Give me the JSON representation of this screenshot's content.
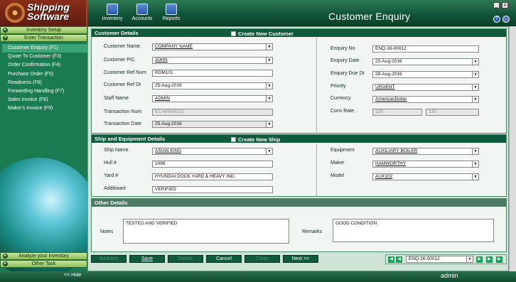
{
  "app": {
    "logo_line1": "Shipping",
    "logo_line2": "Software",
    "title": "Customer Enquiry",
    "user": "admin",
    "hide_label": "<< Hide"
  },
  "toolbar": [
    {
      "label": "Inventory",
      "icon": "inventory-icon"
    },
    {
      "label": "Accounts",
      "icon": "accounts-icon"
    },
    {
      "label": "Reports",
      "icon": "reports-icon"
    }
  ],
  "window_controls": {
    "minimize": "_",
    "close": "x",
    "help": "?"
  },
  "sidebar": {
    "inventory_setup": "Inventory Setup",
    "enter_transaction": "Enter Transaction",
    "items": [
      "Customer Enquiry (F1)",
      "Quote To Customer (F3)",
      "Order Confirmation (F4)",
      "Purchase Order (F5)",
      "Readiness (F6)",
      "Forwarding Handling (F7)",
      "Sales Invoice (F8)",
      "Maker's Invoice (F9)"
    ],
    "analyze": "Analyze your inventory",
    "other": "Other Task"
  },
  "customer": {
    "header": "Customer Details",
    "create_label": "Create New Customer",
    "name_label": "Customer Name",
    "name": "COMPANY NAME",
    "pic_label": "Customer PIC",
    "pic": "JOHN",
    "ref_label": "Customer Ref Num",
    "ref": "RDM101",
    "refdt_label": "Customer Ref Dt",
    "refdt": "25-Aug-2016",
    "staff_label": "Staff  Name",
    "staff": "ADMIN",
    "txnum_label": "Transaction Num",
    "txnum": "EC-60800013",
    "txdate_label": "Transaction Date",
    "txdate": "25-Aug-2016",
    "enq_label": "Enquiry No",
    "enq": "ENQ-16-00012",
    "enqdate_label": "Enquiry Date",
    "enqdate": "25-Aug-2016",
    "due_label": "Enquiry Due Dt",
    "due": "28-Aug-2016",
    "priority_label": "Priority",
    "priority": "URGENT",
    "currency_label": "Currency",
    "currency": "AmericanDollar",
    "conv_label": "Conv Rate",
    "conv1": "120",
    "conv2": "120"
  },
  "ship": {
    "header": "Ship and Equipment Details",
    "create_label": "Create New Ship",
    "name_label": "Ship Name",
    "name": "ASIAN KING",
    "hull_label": "Hull #",
    "hull": "1098",
    "yard_label": "Yard #",
    "yard": "HYUNDAI DOCK YARD & HEAVY IND.",
    "add_label": "Additioanl",
    "add": "VERIFIED",
    "equip_label": "Equipment",
    "equip": "AUXILIARY BOILER",
    "maker_label": "Maker",
    "maker": "HAMWORTHY",
    "model_label": "Model",
    "model": "AUX102"
  },
  "other": {
    "header": "Other Details",
    "notes_label": "Notes",
    "notes": "TESTED AND VERIFIED",
    "remarks_label": "Remarks",
    "remarks": "GOOD CONDITION"
  },
  "buttons": {
    "addnew": "AddNew",
    "save": "Save",
    "delete": "Delete",
    "cancel": "Cancel",
    "close": "Close",
    "next": "Next >>"
  },
  "navigator": {
    "current": "ENQ-16-00012"
  }
}
